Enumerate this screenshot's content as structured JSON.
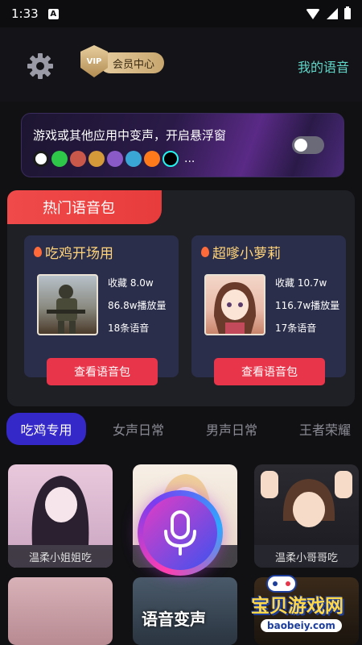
{
  "status": {
    "time": "1:33",
    "notif_letter": "A"
  },
  "header": {
    "vip_badge": "VIP",
    "vip_label": "会员中心",
    "my_voice": "我的语音"
  },
  "float_banner": {
    "title": "游戏或其他应用中变声，开启悬浮窗",
    "more": "...",
    "toggle_on": false,
    "app_icons": [
      "qq-icon",
      "wechat-icon",
      "game-icon-1",
      "game-icon-2",
      "game-icon-3",
      "game-icon-4",
      "kuaishou-icon",
      "tiktok-icon"
    ]
  },
  "hot": {
    "title": "热门语音包",
    "packs": [
      {
        "name": "吃鸡开场用",
        "favorites": "收藏 8.0w",
        "plays": "86.8w播放量",
        "count": "18条语音",
        "button": "查看语音包"
      },
      {
        "name": "超嗲小萝莉",
        "favorites": "收藏 10.7w",
        "plays": "116.7w播放量",
        "count": "17条语音",
        "button": "查看语音包"
      }
    ]
  },
  "tabs": [
    {
      "label": "吃鸡专用",
      "active": true
    },
    {
      "label": "女声日常",
      "active": false
    },
    {
      "label": "男声日常",
      "active": false
    },
    {
      "label": "王者荣耀",
      "active": false
    }
  ],
  "grid": [
    {
      "label": "温柔小姐姐吃"
    },
    {
      "label": ""
    },
    {
      "label": "温柔小哥哥吃"
    }
  ],
  "fab": {
    "label": "语音变声"
  },
  "watermark": {
    "text": "宝贝游戏网",
    "url": "baobeiy.com"
  },
  "colors": {
    "accent": "#3528c8",
    "hot_red": "#e8354a",
    "teal": "#5fd6c8",
    "gold": "#ffd37a"
  }
}
